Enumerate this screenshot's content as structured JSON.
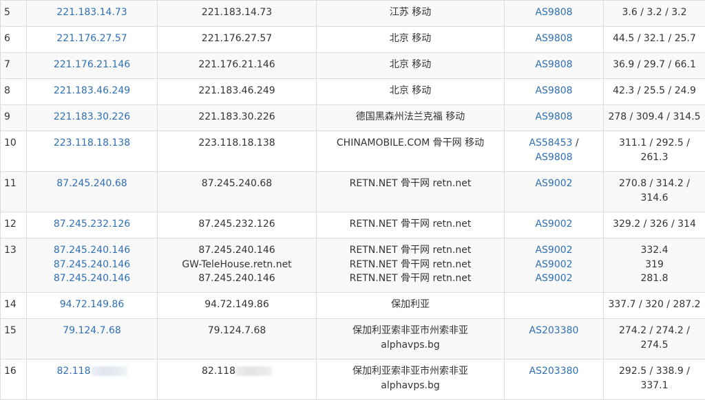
{
  "colors": {
    "link": "#2e6fb3",
    "text": "#333333",
    "border": "#dcdcdc",
    "row_alt": "#f9f9f9"
  },
  "rows": [
    {
      "num": "5",
      "ip": [
        "221.183.14.73"
      ],
      "host": [
        "221.183.14.73"
      ],
      "loc": [
        "江苏 移动"
      ],
      "as": [
        "AS9808"
      ],
      "time": [
        "3.6 / 3.2 / 3.2"
      ]
    },
    {
      "num": "6",
      "ip": [
        "221.176.27.57"
      ],
      "host": [
        "221.176.27.57"
      ],
      "loc": [
        "北京 移动"
      ],
      "as": [
        "AS9808"
      ],
      "time": [
        "44.5 / 32.1 / 25.7"
      ]
    },
    {
      "num": "7",
      "ip": [
        "221.176.21.146"
      ],
      "host": [
        "221.176.21.146"
      ],
      "loc": [
        "北京 移动"
      ],
      "as": [
        "AS9808"
      ],
      "time": [
        "36.9 / 29.7 / 66.1"
      ]
    },
    {
      "num": "8",
      "ip": [
        "221.183.46.249"
      ],
      "host": [
        "221.183.46.249"
      ],
      "loc": [
        "北京 移动"
      ],
      "as": [
        "AS9808"
      ],
      "time": [
        "42.3 / 25.5 / 24.9"
      ]
    },
    {
      "num": "9",
      "ip": [
        "221.183.30.226"
      ],
      "host": [
        "221.183.30.226"
      ],
      "loc": [
        "德国黑森州法兰克福 移动"
      ],
      "as": [
        "AS9808"
      ],
      "time": [
        "278 / 309.4 / 314.5"
      ]
    },
    {
      "num": "10",
      "ip": [
        "223.118.18.138"
      ],
      "host": [
        "223.118.18.138"
      ],
      "loc": [
        "CHINAMOBILE.COM 骨干网 移动"
      ],
      "as_first": "AS58453",
      "as_sep": " /",
      "as_second": "AS9808",
      "time": [
        "311.1 / 292.5 /",
        "261.3"
      ]
    },
    {
      "num": "11",
      "ip": [
        "87.245.240.68"
      ],
      "host": [
        "87.245.240.68"
      ],
      "loc": [
        "RETN.NET 骨干网 retn.net"
      ],
      "as": [
        "AS9002"
      ],
      "time": [
        "270.8 / 314.2 /",
        "314.6"
      ]
    },
    {
      "num": "12",
      "ip": [
        "87.245.232.126"
      ],
      "host": [
        "87.245.232.126"
      ],
      "loc": [
        "RETN.NET 骨干网 retn.net"
      ],
      "as": [
        "AS9002"
      ],
      "time": [
        "329.2 / 326 / 314"
      ]
    },
    {
      "num": "13",
      "ip": [
        "87.245.240.146",
        "87.245.240.146",
        "87.245.240.146"
      ],
      "host": [
        "87.245.240.146",
        "GW-TeleHouse.retn.net",
        "87.245.240.146"
      ],
      "loc": [
        "RETN.NET 骨干网 retn.net",
        "RETN.NET 骨干网 retn.net",
        "RETN.NET 骨干网 retn.net"
      ],
      "as": [
        "AS9002",
        "AS9002",
        "AS9002"
      ],
      "time": [
        "332.4",
        "319",
        "281.8"
      ]
    },
    {
      "num": "14",
      "ip": [
        "94.72.149.86"
      ],
      "host": [
        "94.72.149.86"
      ],
      "loc": [
        "保加利亚"
      ],
      "as": [],
      "time": [
        "337.7 / 320 / 287.2"
      ]
    },
    {
      "num": "15",
      "ip": [
        "79.124.7.68"
      ],
      "host": [
        "79.124.7.68"
      ],
      "loc": [
        "保加利亚索非亚市州索非亚",
        "alphavps.bg"
      ],
      "as": [
        "AS203380"
      ],
      "time": [
        "274.2 / 274.2 /",
        "274.5"
      ]
    },
    {
      "num": "16",
      "ip": [
        "82.118"
      ],
      "host": [
        "82.118"
      ],
      "loc": [
        "保加利亚索非亚市州索非亚",
        "alphavps.bg"
      ],
      "as": [
        "AS203380"
      ],
      "time": [
        "292.5 / 338.9 /",
        "337.1"
      ]
    }
  ]
}
